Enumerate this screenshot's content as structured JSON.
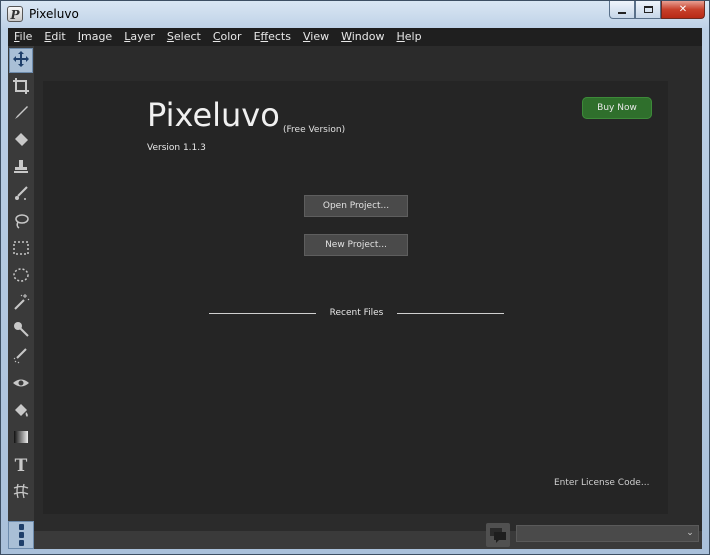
{
  "window": {
    "title": "Pixeluvo",
    "app_icon_letter": "P",
    "close_glyph": "✕"
  },
  "menu": [
    {
      "label": "File",
      "key": "F",
      "rest": "ile"
    },
    {
      "label": "Edit",
      "key": "E",
      "rest": "dit"
    },
    {
      "label": "Image",
      "key": "I",
      "rest": "mage"
    },
    {
      "label": "Layer",
      "key": "L",
      "rest": "ayer"
    },
    {
      "label": "Select",
      "key": "S",
      "rest": "elect"
    },
    {
      "label": "Color",
      "key": "C",
      "rest": "olor"
    },
    {
      "label": "Effects",
      "key": "f",
      "pre": "E",
      "rest": "fects"
    },
    {
      "label": "View",
      "key": "V",
      "rest": "iew"
    },
    {
      "label": "Window",
      "key": "W",
      "rest": "indow"
    },
    {
      "label": "Help",
      "key": "H",
      "rest": "elp"
    }
  ],
  "tools": [
    {
      "name": "move-tool",
      "icon": "move-icon",
      "active": true
    },
    {
      "name": "crop-tool",
      "icon": "crop-icon"
    },
    {
      "name": "brush-tool",
      "icon": "brush-icon"
    },
    {
      "name": "eraser-tool",
      "icon": "eraser-icon"
    },
    {
      "name": "clone-stamp-tool",
      "icon": "stamp-icon"
    },
    {
      "name": "healing-tool",
      "icon": "healing-brush-icon"
    },
    {
      "name": "lasso-tool",
      "icon": "lasso-icon"
    },
    {
      "name": "rect-select-tool",
      "icon": "rectangle-select-icon"
    },
    {
      "name": "ellipse-select-tool",
      "icon": "ellipse-select-icon"
    },
    {
      "name": "magic-wand-tool",
      "icon": "magic-wand-icon"
    },
    {
      "name": "quick-select-tool",
      "icon": "quick-select-icon"
    },
    {
      "name": "dodge-burn-tool",
      "icon": "dodge-burn-icon"
    },
    {
      "name": "red-eye-tool",
      "icon": "eye-icon"
    },
    {
      "name": "fill-tool",
      "icon": "paint-bucket-icon"
    },
    {
      "name": "gradient-tool",
      "icon": "gradient-icon"
    },
    {
      "name": "text-tool",
      "icon": "text-icon",
      "glyph": "T"
    },
    {
      "name": "warp-tool",
      "icon": "warp-icon"
    }
  ],
  "welcome": {
    "app_name": "Pixeluvo",
    "edition": "(Free Version)",
    "version": "Version 1.1.3",
    "buy_now": "Buy Now",
    "open_project": "Open Project...",
    "new_project": "New Project...",
    "recent_files": "Recent Files",
    "license": "Enter License Code..."
  },
  "colors": {
    "accent_green": "#2f6f2c",
    "active_tool": "#a9bfd6",
    "background": "#252525"
  },
  "status": {
    "combo_value": "",
    "combo_arrow": "⌄"
  }
}
